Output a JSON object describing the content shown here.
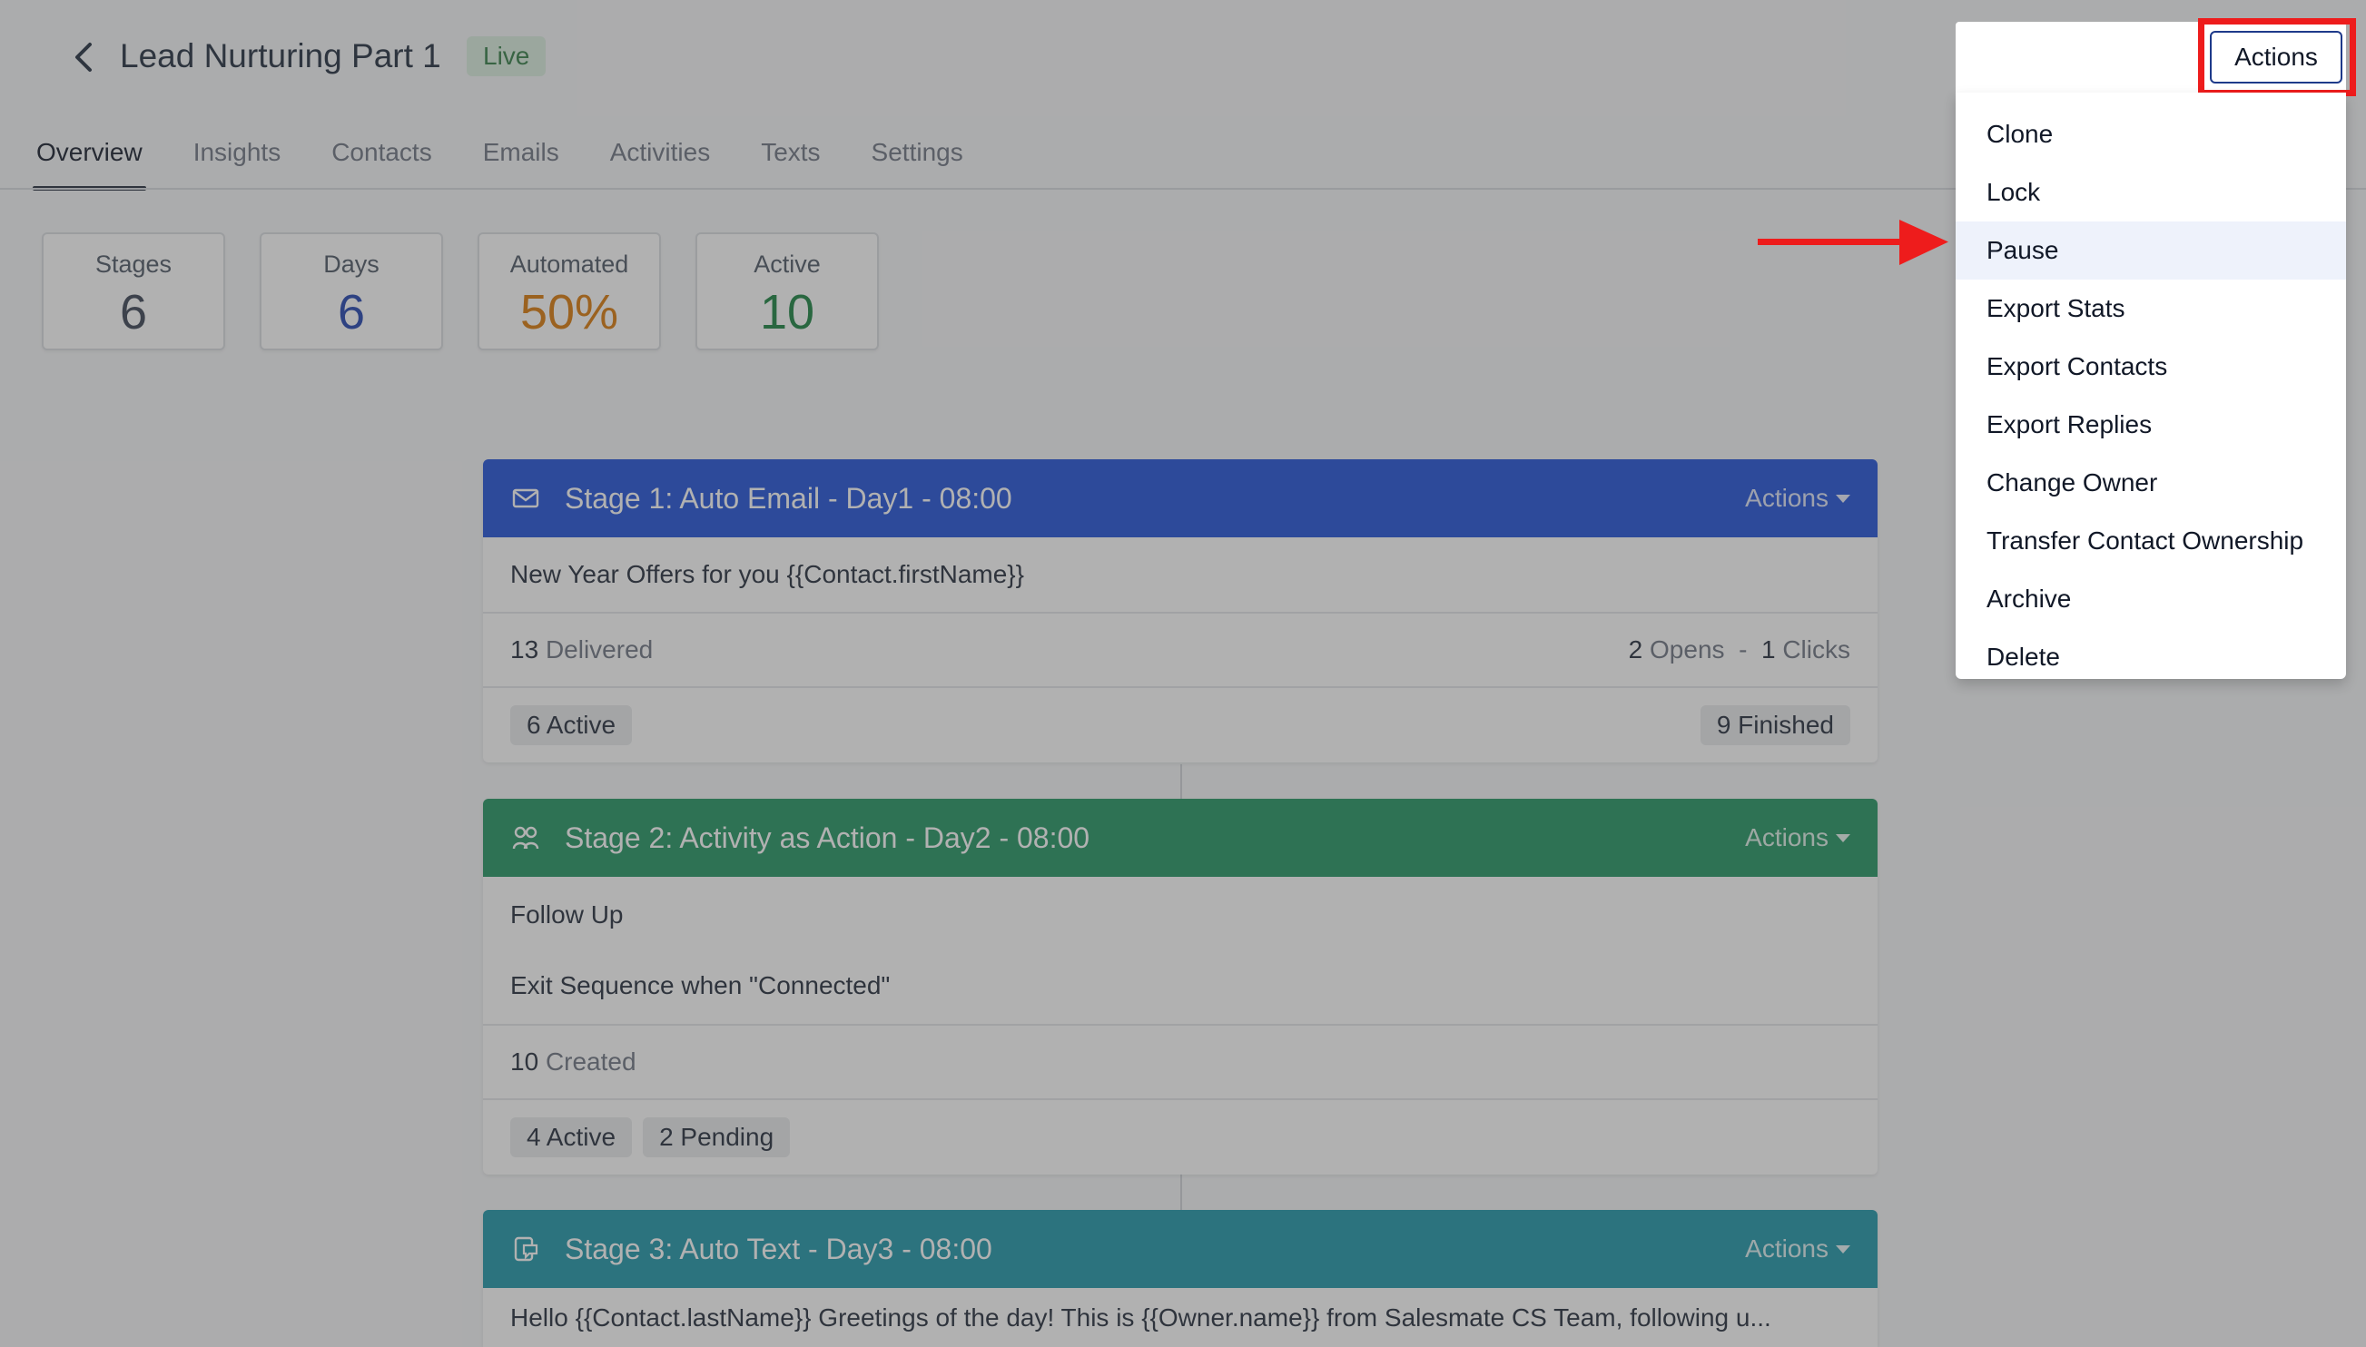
{
  "header": {
    "title": "Lead Nurturing Part 1",
    "status_badge": "Live"
  },
  "tabs": [
    {
      "label": "Overview",
      "active": true
    },
    {
      "label": "Insights",
      "active": false
    },
    {
      "label": "Contacts",
      "active": false
    },
    {
      "label": "Emails",
      "active": false
    },
    {
      "label": "Activities",
      "active": false
    },
    {
      "label": "Texts",
      "active": false
    },
    {
      "label": "Settings",
      "active": false
    }
  ],
  "stats": [
    {
      "label": "Stages",
      "value": "6",
      "color": "#374151"
    },
    {
      "label": "Days",
      "value": "6",
      "color": "#1e40af"
    },
    {
      "label": "Automated",
      "value": "50%",
      "color": "#d97706"
    },
    {
      "label": "Active",
      "value": "10",
      "color": "#15803d"
    }
  ],
  "stages": [
    {
      "title": "Stage 1: Auto Email - Day1 - 08:00",
      "actions_label": "Actions",
      "icon": "envelope-icon",
      "color": "#1d4ed8",
      "subject": "New Year Offers for you {{Contact.firstName}}",
      "delivered_count": "13",
      "delivered_label": "Delivered",
      "opens_count": "2",
      "opens_label": "Opens",
      "separator": "-",
      "clicks_count": "1",
      "clicks_label": "Clicks",
      "active_chip": "6 Active",
      "finished_chip": "9 Finished"
    },
    {
      "title": "Stage 2: Activity as Action - Day2 - 08:00",
      "actions_label": "Actions",
      "icon": "activity-icon",
      "color": "#1e9360",
      "line1": "Follow Up",
      "line2": "Exit Sequence when \"Connected\"",
      "created_count": "10",
      "created_label": "Created",
      "active_chip": "4 Active",
      "pending_chip": "2 Pending"
    },
    {
      "title": "Stage 3: Auto Text - Day3 - 08:00",
      "actions_label": "Actions",
      "icon": "text-message-icon",
      "color": "#1a95a8",
      "message": "Hello {{Contact.lastName}} Greetings of the day! This is {{Owner.name}} from Salesmate CS Team, following u..."
    }
  ],
  "actions_dropdown": {
    "button_label": "Actions",
    "items": [
      "Clone",
      "Lock",
      "Pause",
      "Export Stats",
      "Export Contacts",
      "Export Replies",
      "Change Owner",
      "Transfer Contact Ownership",
      "Archive",
      "Delete"
    ],
    "hovered_item": "Pause"
  },
  "colors": {
    "highlight": "#ee1c1c",
    "overlay": "rgba(70,70,70,0.42)"
  }
}
